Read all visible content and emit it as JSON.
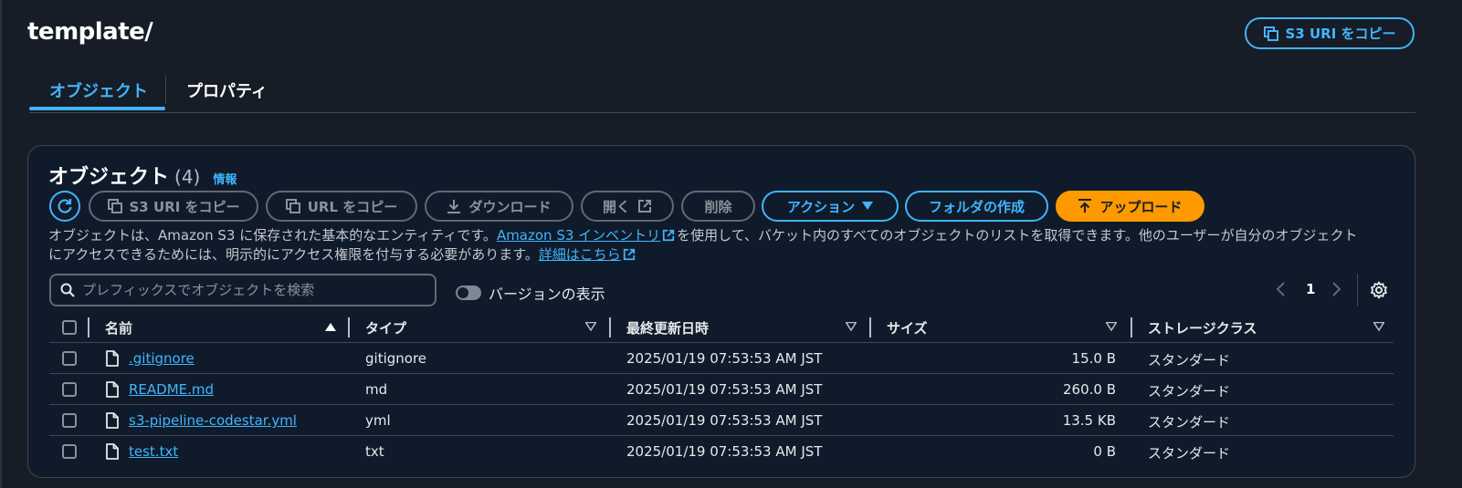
{
  "header": {
    "title": "template/",
    "copy_uri_label": "S3 URI をコピー"
  },
  "tabs": [
    {
      "label": "オブジェクト",
      "active": true
    },
    {
      "label": "プロパティ",
      "active": false
    }
  ],
  "objects_panel": {
    "title": "オブジェクト",
    "count": "(4)",
    "info_label": "情報",
    "toolbar": {
      "copy_s3_uri": "S3 URI をコピー",
      "copy_url": "URL をコピー",
      "download": "ダウンロード",
      "open": "開く",
      "delete": "削除",
      "actions": "アクション",
      "create_folder": "フォルダの作成",
      "upload": "アップロード"
    },
    "description": {
      "part1": "オブジェクトは、Amazon S3 に保存された基本的なエンティティです。",
      "inventory_link": "Amazon S3 インベントリ",
      "part2": "を使用して、バケット内のすべてのオブジェクトのリストを取得できます。他のユーザーが自分のオブジェクト",
      "part3": "にアクセスできるためには、明示的にアクセス権限を付与する必要があります。",
      "details_link": "詳細はこちら"
    },
    "search": {
      "placeholder": "プレフィックスでオブジェクトを検索",
      "value": ""
    },
    "version_toggle_label": "バージョンの表示",
    "pagination": {
      "current_page": "1"
    },
    "columns": {
      "name": "名前",
      "type": "タイプ",
      "last_modified": "最終更新日時",
      "size": "サイズ",
      "storage_class": "ストレージクラス"
    },
    "rows": [
      {
        "name": ".gitignore",
        "type": "gitignore",
        "last_modified": "2025/01/19 07:53:53 AM JST",
        "size": "15.0 B",
        "storage_class": "スタンダード"
      },
      {
        "name": "README.md",
        "type": "md",
        "last_modified": "2025/01/19 07:53:53 AM JST",
        "size": "260.0 B",
        "storage_class": "スタンダード"
      },
      {
        "name": "s3-pipeline-codestar.yml",
        "type": "yml",
        "last_modified": "2025/01/19 07:53:53 AM JST",
        "size": "13.5 KB",
        "storage_class": "スタンダード"
      },
      {
        "name": "test.txt",
        "type": "txt",
        "last_modified": "2025/01/19 07:53:53 AM JST",
        "size": "0 B",
        "storage_class": "スタンダード"
      }
    ]
  },
  "colors": {
    "background": "#161d26",
    "accent": "#42b4ff",
    "primary_orange": "#ff9900",
    "border": "#414750"
  },
  "icons": [
    "copy-icon",
    "refresh-icon",
    "download-icon",
    "external-link-icon",
    "caret-down-icon",
    "upload-icon",
    "search-icon",
    "chevron-left-icon",
    "chevron-right-icon",
    "gear-icon",
    "file-icon",
    "sort-ascending-icon",
    "sort-descending-icon"
  ]
}
